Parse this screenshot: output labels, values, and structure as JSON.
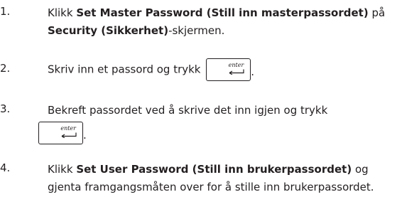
{
  "steps": [
    {
      "number": "1.",
      "pre": "Klikk ",
      "bold1": "Set Master Password (Still inn masterpassordet)",
      "mid": " på",
      "bold2": "Security (Sikkerhet)",
      "post": "-skjermen."
    },
    {
      "number": "2.",
      "text": "Skriv inn et passord og trykk",
      "after_key": "."
    },
    {
      "number": "3.",
      "text": "Bekreft passordet ved å skrive det inn igjen og trykk",
      "after_key": "."
    },
    {
      "number": "4.",
      "pre": "Klikk ",
      "bold1": "Set User Password (Still inn brukerpassordet)",
      "mid": " og",
      "line2": "gjenta framgangsmåten over for å stille inn brukerpassordet."
    }
  ],
  "enter_key": {
    "label": "enter",
    "icon": "enter-arrow-icon"
  }
}
